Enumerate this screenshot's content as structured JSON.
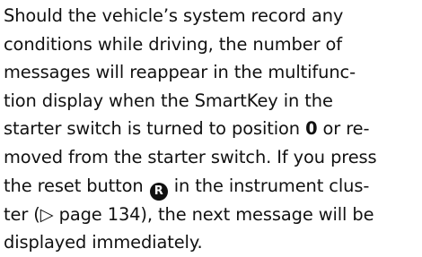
{
  "paragraph": {
    "line1": "Should the vehicle’s system record any",
    "line2": "conditions while driving, the number of",
    "line3": "messages will reappear in the multifunc-",
    "line4": "tion display when the SmartKey in the",
    "line5_pre": "starter switch is turned to position ",
    "line5_position": "0",
    "line5_post": " or re-",
    "line6": "moved from the starter switch. If you press",
    "line7_pre": "the reset button ",
    "line7_post": " in the instrument clus-",
    "line8": "ter (▷ page 134), the next message will be",
    "line9": "displayed immediately."
  },
  "icons": {
    "reset_button_glyph": "R",
    "reset_button_icon": "reset-button-icon"
  }
}
